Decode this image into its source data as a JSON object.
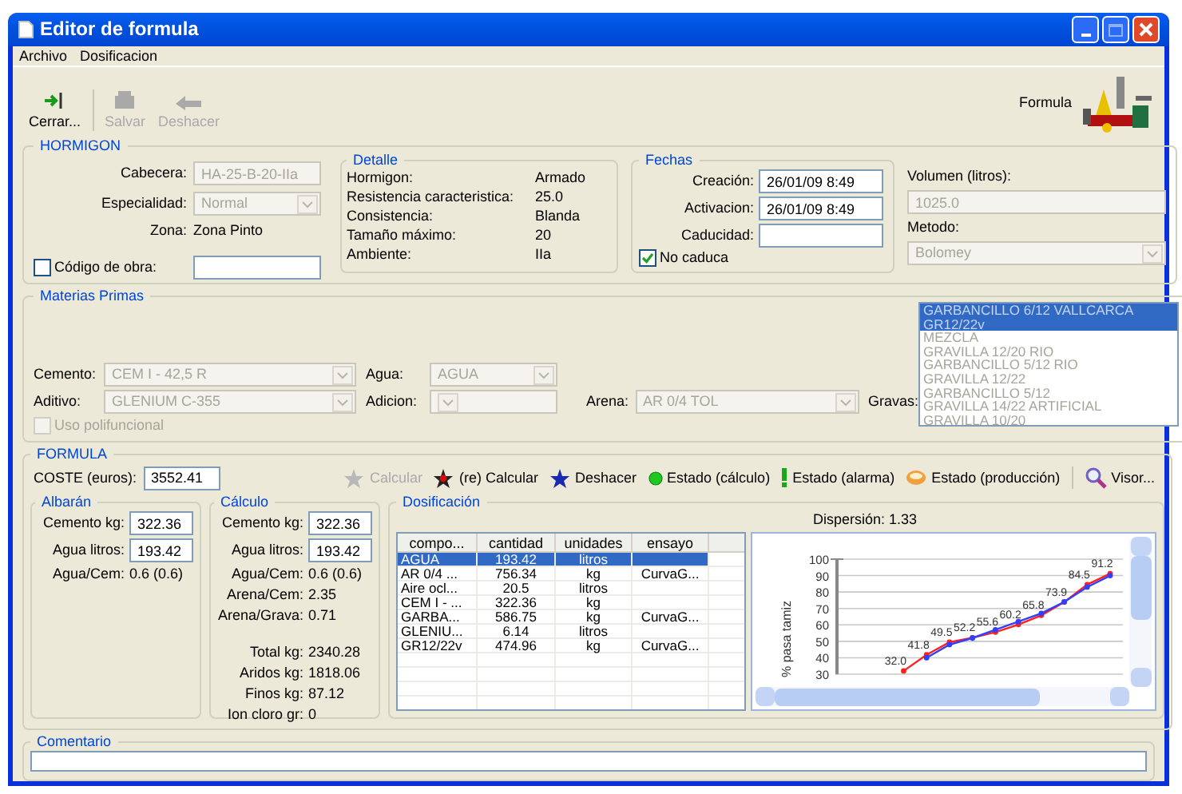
{
  "window": {
    "title": "Editor de formula"
  },
  "menu": [
    "Archivo",
    "Dosificacion"
  ],
  "toolbar": {
    "items": [
      {
        "label": "Cerrar...",
        "kind": "close",
        "disabled": false
      },
      {
        "label": "Salvar",
        "kind": "save",
        "disabled": true
      },
      {
        "label": "Deshacer",
        "kind": "undo",
        "disabled": true
      }
    ],
    "caption": "Formula"
  },
  "hormigon": {
    "title": "HORMIGON",
    "cabecera": {
      "label": "Cabecera:",
      "value": "HA-25-B-20-IIa",
      "disabled": true
    },
    "especialidad": {
      "label": "Especialidad:",
      "value": "Normal",
      "disabled": true
    },
    "zona": {
      "label": "Zona:",
      "value": "Zona Pinto"
    },
    "codigo_obra": {
      "label": "Código de obra:",
      "checked": false
    },
    "detalle": {
      "title": "Detalle",
      "rows": [
        {
          "label": "Hormigon:",
          "value": "Armado"
        },
        {
          "label": "Resistencia caracteristica:",
          "value": "25.0"
        },
        {
          "label": "Consistencia:",
          "value": "Blanda"
        },
        {
          "label": "Tamaño máximo:",
          "value": "20"
        },
        {
          "label": "Ambiente:",
          "value": "IIa"
        }
      ]
    },
    "fechas": {
      "title": "Fechas",
      "rows": [
        {
          "label": "Creación:",
          "value": "26/01/09 8:49"
        },
        {
          "label": "Activacion:",
          "value": "26/01/09 8:49"
        },
        {
          "label": "Caducidad:"
        }
      ],
      "no_caduca": {
        "label": "No caduca",
        "checked": true
      }
    },
    "volumen": {
      "label": "Volumen  (litros):",
      "value": "1025.0",
      "disabled": true
    },
    "metodo": {
      "label": "Metodo:",
      "value": "Bolomey",
      "disabled": true
    }
  },
  "materias_primas": {
    "title": "Materias Primas",
    "cemento": {
      "label": "Cemento:",
      "value": "CEM I - 42,5 R",
      "disabled": true
    },
    "agua": {
      "label": "Agua:",
      "value": "AGUA",
      "disabled": true
    },
    "aditivo": {
      "label": "Aditivo:",
      "value": "GLENIUM C-355",
      "disabled": true
    },
    "adicion": {
      "label": "Adicion:",
      "disabled": true
    },
    "arena": {
      "label": "Arena:",
      "value": "AR 0/4 TOL",
      "disabled": true
    },
    "uso_polifuncional": {
      "label": "Uso polifuncional",
      "checked": false,
      "disabled": true
    },
    "gravas": {
      "label": "Gravas:",
      "items": [
        {
          "text": "GARBANCILLO 6/12 VALLCARCA",
          "selected": true
        },
        {
          "text": "GR12/22v",
          "selected": true
        },
        {
          "text": "MEZCLA",
          "selected": false
        },
        {
          "text": "GRAVILLA 12/20 RIO",
          "selected": false
        },
        {
          "text": "GARBANCILLO 5/12 RIO",
          "selected": false
        },
        {
          "text": "GRAVILLA 12/22",
          "selected": false
        },
        {
          "text": "GARBANCILLO 5/12",
          "selected": false
        },
        {
          "text": "GRAVILLA 14/22  ARTIFICIAL",
          "selected": false
        },
        {
          "text": "GRAVILLA 10/20",
          "selected": false
        }
      ]
    }
  },
  "formula": {
    "title": "FORMULA",
    "coste": {
      "label": "COSTE (euros):",
      "value": "3552.41"
    },
    "actions": [
      {
        "label": "Calcular",
        "kind": "star",
        "disabled": true
      },
      {
        "label": "(re) Calcular",
        "kind": "runner",
        "disabled": false
      },
      {
        "label": "Deshacer",
        "kind": "figure",
        "disabled": false
      },
      {
        "label": "Estado (cálculo)",
        "kind": "dot",
        "disabled": false
      },
      {
        "label": "Estado (alarma)",
        "kind": "exclamation",
        "disabled": false
      },
      {
        "label": "Estado (producción)",
        "kind": "bowl",
        "disabled": false
      },
      {
        "label": "Visor...",
        "kind": "magnifier",
        "disabled": false
      }
    ],
    "albaran": {
      "title": "Albarán",
      "inputs": [
        {
          "label": "Cemento kg:",
          "value": "322.36"
        },
        {
          "label": "Agua litros:",
          "value": "193.42"
        }
      ],
      "rows": [
        {
          "label": "Agua/Cem:",
          "value": "0.6 (0.6)"
        }
      ]
    },
    "calculo": {
      "title": "Cálculo",
      "inputs": [
        {
          "label": "Cemento kg:",
          "value": "322.36"
        },
        {
          "label": "Agua litros:",
          "value": "193.42"
        }
      ],
      "rows": [
        {
          "label": "Agua/Cem:",
          "value": "0.6 (0.6)"
        },
        {
          "label": "Arena/Cem:",
          "value": "2.35"
        },
        {
          "label": "Arena/Grava:",
          "value": "0.71"
        }
      ],
      "totals": [
        {
          "label": "Total kg:",
          "value": "2340.28"
        },
        {
          "label": "Aridos kg:",
          "value": "1818.06"
        },
        {
          "label": "Finos kg:",
          "value": "87.12"
        },
        {
          "label": "Ion cloro gr:",
          "value": "0"
        }
      ]
    },
    "dosificacion": {
      "title": "Dosificación",
      "dispersion": "Dispersión: 1.33",
      "columns": [
        "compo...",
        "cantidad",
        "unidades",
        "ensayo"
      ],
      "rows": [
        {
          "cells": [
            "AGUA",
            "193.42",
            "litros",
            ""
          ],
          "selected": true
        },
        {
          "cells": [
            "AR 0/4 ...",
            "756.34",
            "kg",
            "CurvaG..."
          ],
          "selected": false
        },
        {
          "cells": [
            "Aire ocl...",
            "20.5",
            "litros",
            ""
          ],
          "selected": false
        },
        {
          "cells": [
            "CEM I - ...",
            "322.36",
            "kg",
            ""
          ],
          "selected": false
        },
        {
          "cells": [
            "GARBA...",
            "586.75",
            "kg",
            "CurvaG..."
          ],
          "selected": false
        },
        {
          "cells": [
            "GLENIU...",
            "6.14",
            "litros",
            ""
          ],
          "selected": false
        },
        {
          "cells": [
            "GR12/22v",
            "474.96",
            "kg",
            "CurvaG..."
          ],
          "selected": false
        }
      ],
      "chart_data": {
        "type": "line",
        "ylabel": "% pasa tamiz",
        "ylim": [
          30,
          100
        ],
        "yticks": [
          30,
          40,
          50,
          60,
          70,
          80,
          90,
          100
        ],
        "grid": true,
        "series": [
          {
            "color": "#ff2020",
            "marker": "circle",
            "values": [
              null,
              null,
              32.0,
              41.8,
              49.5,
              52.2,
              55.6,
              60.2,
              65.8,
              73.9,
              84.5,
              91.2
            ],
            "value_labels": [
              null,
              null,
              "32.0",
              "41.8",
              "49.5",
              "52.2",
              "55.6",
              "60.2",
              "65.8",
              "73.9",
              "84.5",
              "91.2"
            ]
          },
          {
            "color": "#3040ff",
            "marker": "circle",
            "values": [
              null,
              null,
              null,
              40,
              48,
              52,
              57,
              62,
              67,
              74,
              83,
              90
            ]
          }
        ]
      }
    }
  },
  "comentario": {
    "title": "Comentario"
  }
}
